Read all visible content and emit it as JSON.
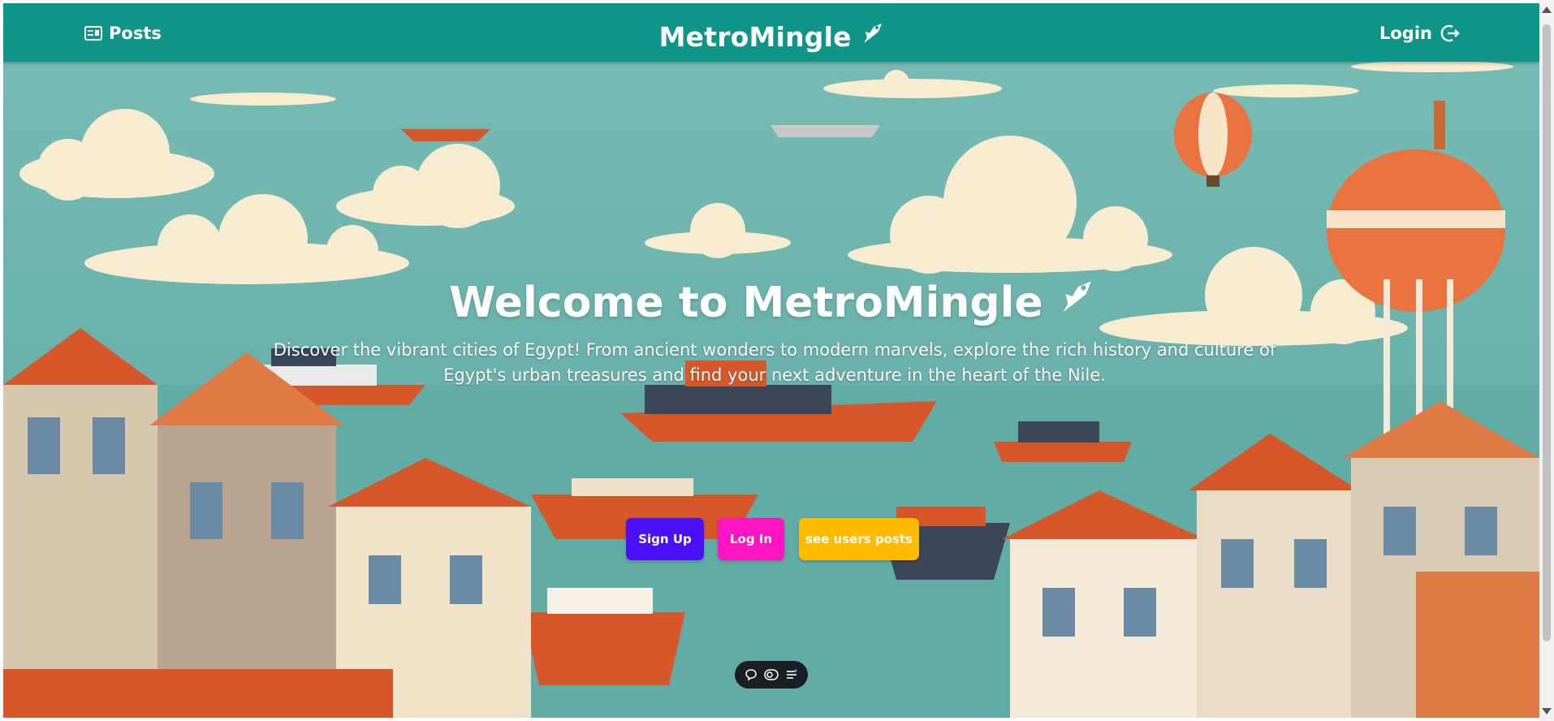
{
  "nav": {
    "posts_label": "Posts",
    "brand": "MetroMingle",
    "login_label": "Login",
    "icons": {
      "posts": "newspaper-icon",
      "brand": "rocket-bird-icon",
      "login": "sign-out-icon"
    }
  },
  "hero": {
    "title": "Welcome to MetroMingle",
    "subtitle": "Discover the vibrant cities of Egypt! From ancient wonders to modern marvels, explore the rich history and culture of Egypt's urban treasures and find your next adventure in the heart of the Nile.",
    "buttons": {
      "signup": "Sign Up",
      "login": "Log In",
      "posts": "see users posts"
    }
  },
  "toolbar": {
    "icons": [
      "chat-bubble-icon",
      "toggle-icon",
      "list-settings-icon"
    ]
  },
  "colors": {
    "navbar": "#0e9587",
    "sky": "#6fb2ac",
    "signup": "#4a0ff4",
    "login": "#ff13c3",
    "posts": "#ffbb00"
  }
}
